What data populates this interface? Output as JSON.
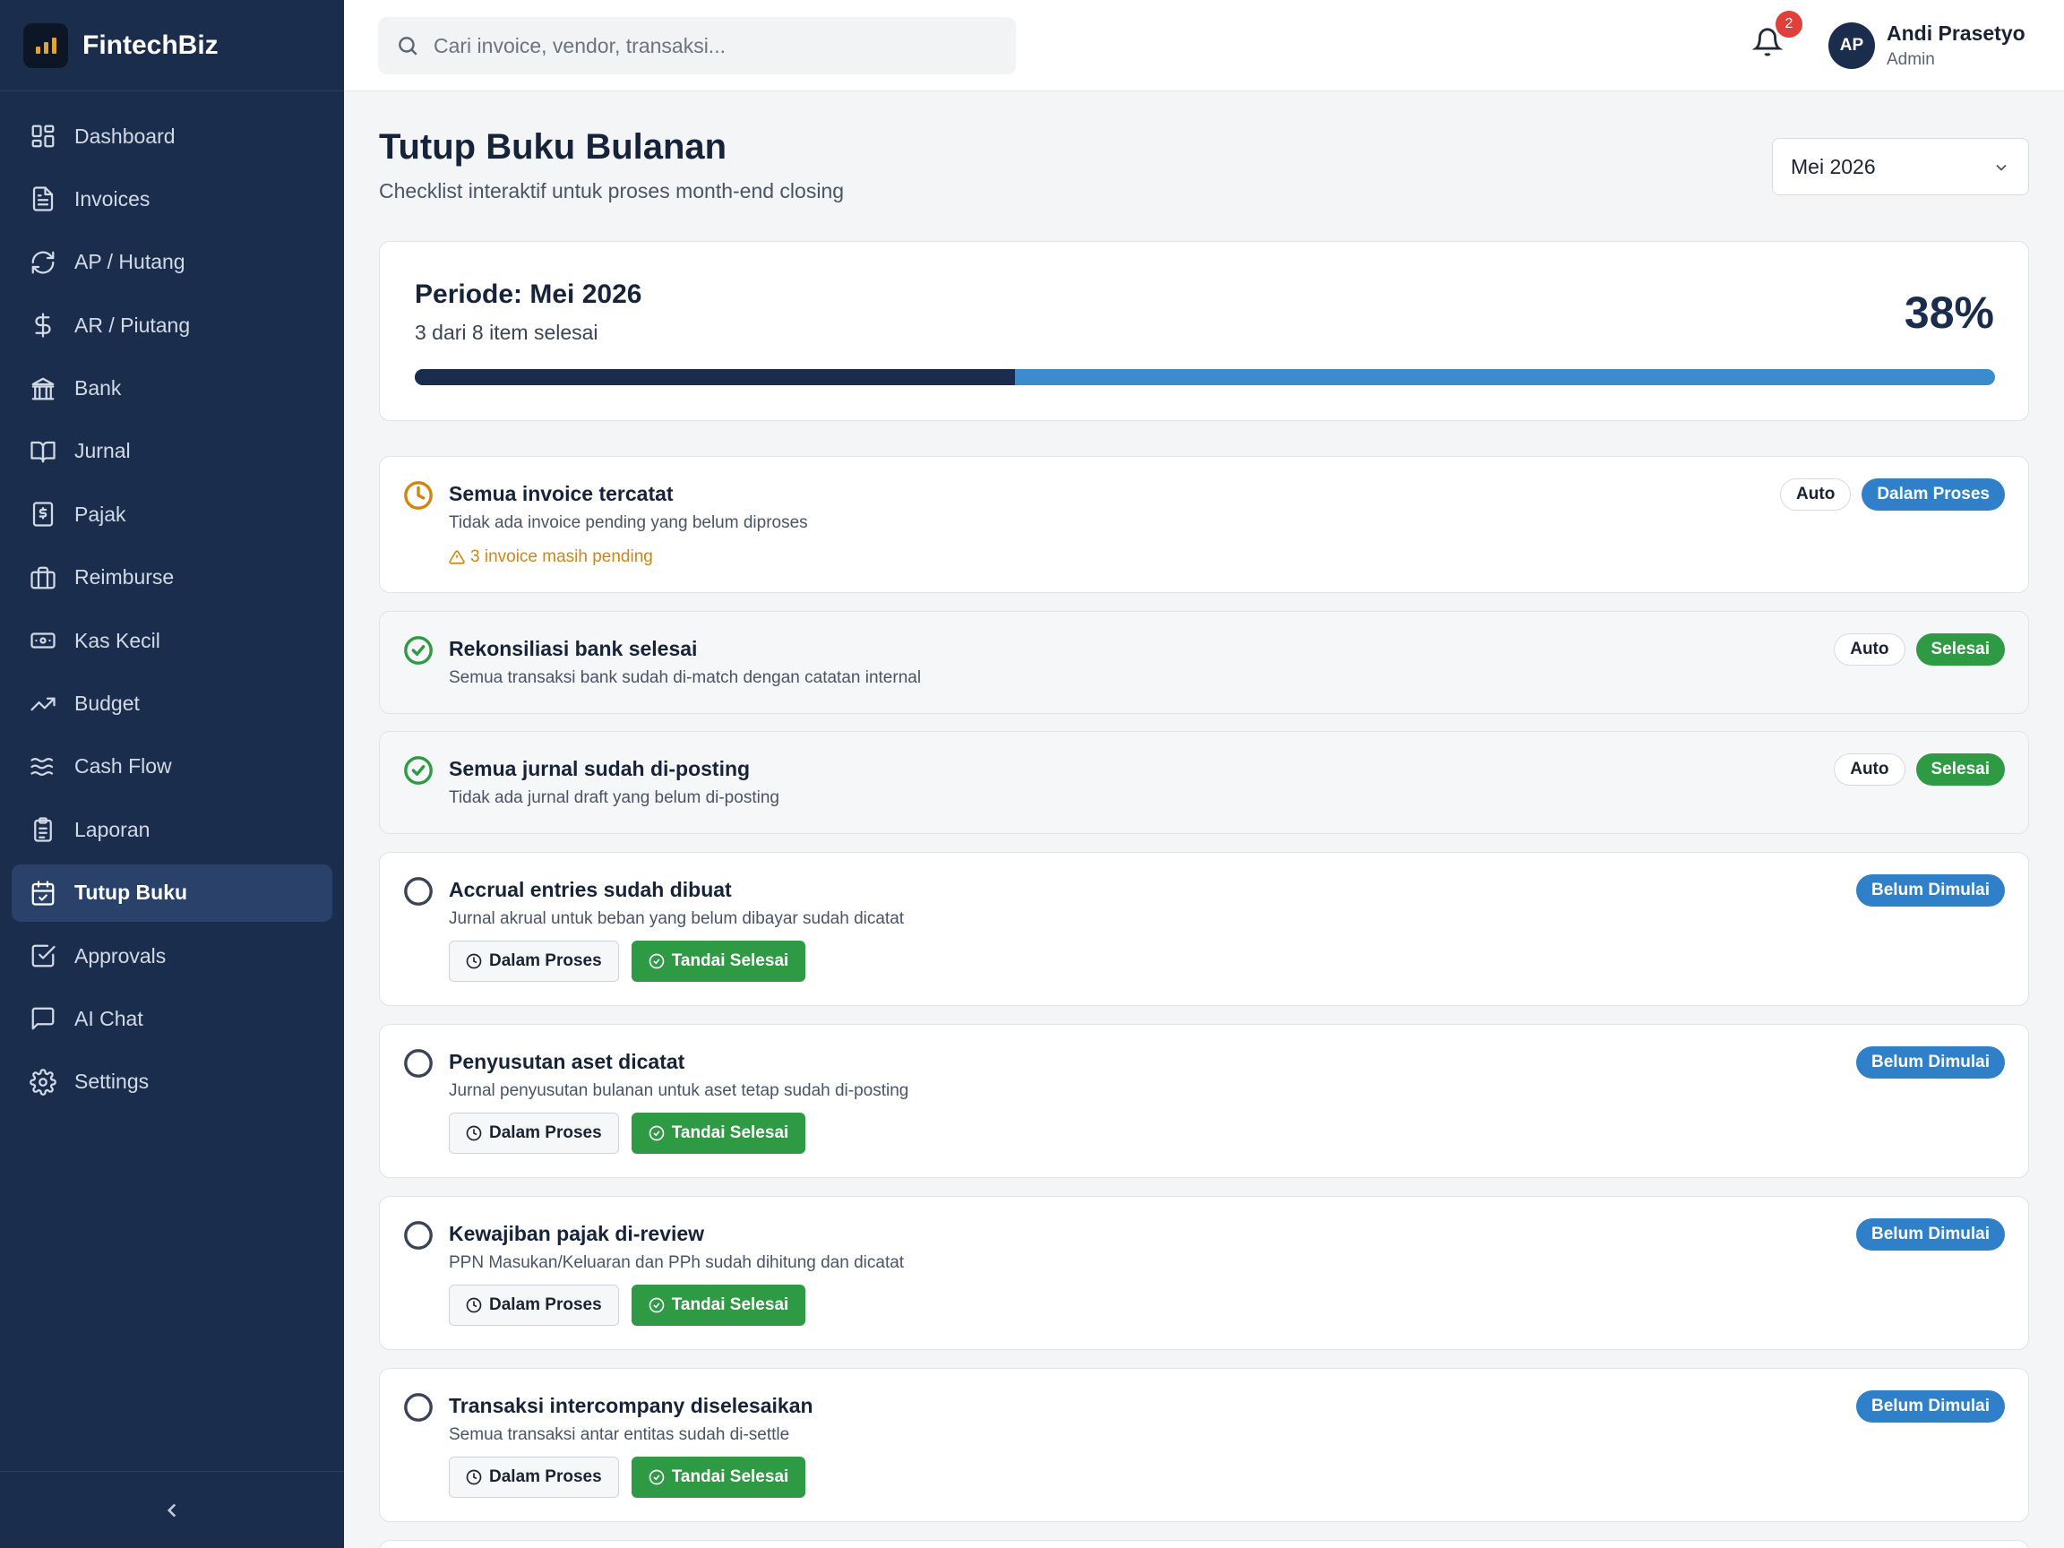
{
  "app": {
    "name": "FintechBiz"
  },
  "sidebar": {
    "items": [
      {
        "label": "Dashboard",
        "icon": "dashboard-icon"
      },
      {
        "label": "Invoices",
        "icon": "file-text-icon"
      },
      {
        "label": "AP / Hutang",
        "icon": "refresh-icon"
      },
      {
        "label": "AR / Piutang",
        "icon": "dollar-icon"
      },
      {
        "label": "Bank",
        "icon": "bank-icon"
      },
      {
        "label": "Jurnal",
        "icon": "book-icon"
      },
      {
        "label": "Pajak",
        "icon": "receipt-icon"
      },
      {
        "label": "Reimburse",
        "icon": "briefcase-icon"
      },
      {
        "label": "Kas Kecil",
        "icon": "banknote-icon"
      },
      {
        "label": "Budget",
        "icon": "trending-up-icon"
      },
      {
        "label": "Cash Flow",
        "icon": "waves-icon"
      },
      {
        "label": "Laporan",
        "icon": "clipboard-icon"
      },
      {
        "label": "Tutup Buku",
        "icon": "calendar-check-icon",
        "active": true
      },
      {
        "label": "Approvals",
        "icon": "check-square-icon"
      },
      {
        "label": "AI Chat",
        "icon": "message-icon"
      },
      {
        "label": "Settings",
        "icon": "gear-icon"
      }
    ]
  },
  "topbar": {
    "search_placeholder": "Cari invoice, vendor, transaksi...",
    "notification_count": "2",
    "user": {
      "initials": "AP",
      "name": "Andi Prasetyo",
      "role": "Admin"
    }
  },
  "page": {
    "title": "Tutup Buku Bulanan",
    "subtitle": "Checklist interaktif untuk proses month-end closing",
    "period_select": "Mei 2026"
  },
  "progress": {
    "period_label": "Periode: Mei 2026",
    "count_text": "3 dari 8 item selesai",
    "percent_text": "38%",
    "fill_fraction": 0.38
  },
  "checklist": [
    {
      "title": "Semua invoice tercatat",
      "desc": "Tidak ada invoice pending yang belum diproses",
      "warning": "3 invoice masih pending",
      "auto_label": "Auto",
      "status_label": "Dalam Proses",
      "status": "proses"
    },
    {
      "title": "Rekonsiliasi bank selesai",
      "desc": "Semua transaksi bank sudah di-match dengan catatan internal",
      "auto_label": "Auto",
      "status_label": "Selesai",
      "status": "selesai"
    },
    {
      "title": "Semua jurnal sudah di-posting",
      "desc": "Tidak ada jurnal draft yang belum di-posting",
      "auto_label": "Auto",
      "status_label": "Selesai",
      "status": "selesai"
    },
    {
      "title": "Accrual entries sudah dibuat",
      "desc": "Jurnal akrual untuk beban yang belum dibayar sudah dicatat",
      "status_label": "Belum Dimulai",
      "status": "belum",
      "btn_progress": "Dalam Proses",
      "btn_done": "Tandai Selesai"
    },
    {
      "title": "Penyusutan aset dicatat",
      "desc": "Jurnal penyusutan bulanan untuk aset tetap sudah di-posting",
      "status_label": "Belum Dimulai",
      "status": "belum",
      "btn_progress": "Dalam Proses",
      "btn_done": "Tandai Selesai"
    },
    {
      "title": "Kewajiban pajak di-review",
      "desc": "PPN Masukan/Keluaran dan PPh sudah dihitung dan dicatat",
      "status_label": "Belum Dimulai",
      "status": "belum",
      "btn_progress": "Dalam Proses",
      "btn_done": "Tandai Selesai"
    },
    {
      "title": "Transaksi intercompany diselesaikan",
      "desc": "Semua transaksi antar entitas sudah di-settle",
      "status_label": "Belum Dimulai",
      "status": "belum",
      "btn_progress": "Dalam Proses",
      "btn_done": "Tandai Selesai"
    }
  ],
  "colors": {
    "sidebar_bg": "#1b2d4d",
    "accent_blue": "#2f80c9",
    "success_green": "#2e9a44",
    "warning_orange": "#d0870f"
  }
}
